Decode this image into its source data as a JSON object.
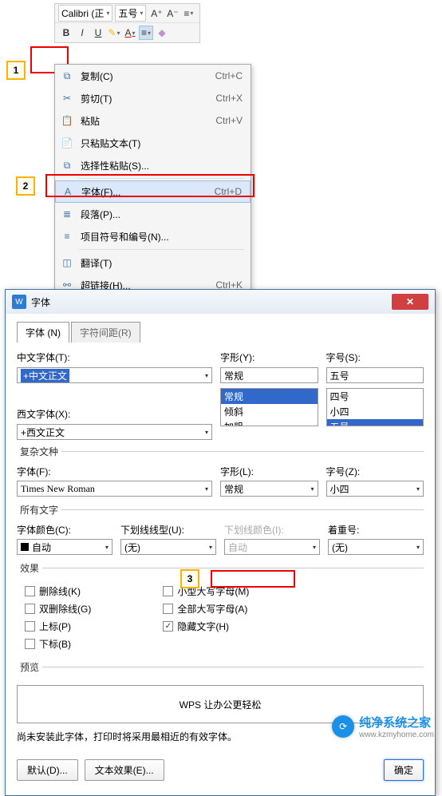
{
  "toolbar": {
    "font_name": "Calibri (正",
    "font_size": "五号"
  },
  "callouts": {
    "n1": "1",
    "n2": "2",
    "n3": "3"
  },
  "ctx": {
    "copy": "复制(C)",
    "copy_sc": "Ctrl+C",
    "cut": "剪切(T)",
    "cut_sc": "Ctrl+X",
    "paste": "粘贴",
    "paste_sc": "Ctrl+V",
    "paste_text": "只粘贴文本(T)",
    "paste_special": "选择性粘贴(S)...",
    "font": "字体(F)...",
    "font_sc": "Ctrl+D",
    "paragraph": "段落(P)...",
    "bullets": "项目符号和编号(N)...",
    "translate": "翻译(T)",
    "hyperlink": "超链接(H)...",
    "hyperlink_sc": "Ctrl+K"
  },
  "dialog": {
    "title": "字体",
    "tab_font": "字体 (N)",
    "tab_spacing": "字符间距(R)",
    "labels": {
      "cn_font": "中文字体(T):",
      "style": "字形(Y):",
      "size": "字号(S):",
      "west_font": "西文字体(X):"
    },
    "cn_font_val": "+中文正文",
    "style_items": {
      "i0": "常规",
      "i1": "倾斜",
      "i2": "加粗"
    },
    "size_items": {
      "i0": "四号",
      "i1": "小四",
      "i2": "五号"
    },
    "west_font_val": "+西文正文",
    "complex": {
      "legend": "复杂文种",
      "font_lbl": "字体(F):",
      "style_lbl": "字形(L):",
      "size_lbl": "字号(Z):",
      "font_val": "Times New Roman",
      "style_val": "常规",
      "size_val": "小四"
    },
    "all_text": {
      "legend": "所有文字",
      "color_lbl": "字体颜色(C):",
      "under_lbl": "下划线线型(U):",
      "ucolor_lbl": "下划线颜色(I):",
      "accent_lbl": "着重号:",
      "auto": "自动",
      "none": "(无)"
    },
    "effects": {
      "legend": "效果",
      "strike": "删除线(K)",
      "dstrike": "双删除线(G)",
      "super": "上标(P)",
      "sub": "下标(B)",
      "smallcap": "小型大写字母(M)",
      "allcap": "全部大写字母(A)",
      "hidden": "隐藏文字(H)"
    },
    "preview": {
      "legend": "预览",
      "text": "WPS 让办公更轻松"
    },
    "note": "尚未安装此字体，打印时将采用最相近的有效字体。",
    "btn_default": "默认(D)...",
    "btn_text_effect": "文本效果(E)...",
    "btn_ok": "确定",
    "style_val": "常规",
    "size_val": "五号"
  },
  "watermark": {
    "line1": "纯净系统之家",
    "line2": "www.kzmyhome.com",
    "icon": "⟳"
  }
}
